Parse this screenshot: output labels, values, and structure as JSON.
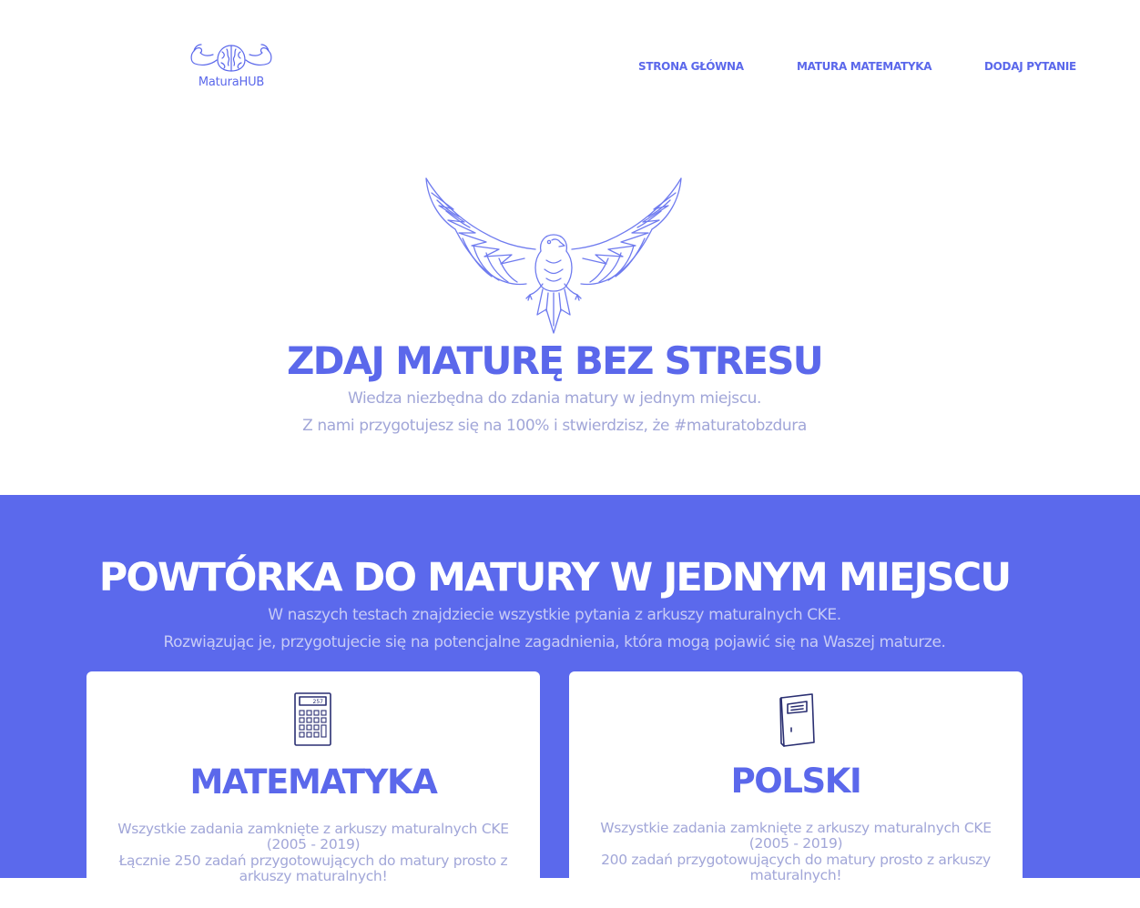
{
  "brand": {
    "logo_text": "MaturaHUB",
    "accent_color": "#5b68eb",
    "band_color": "#5b69ec"
  },
  "nav": {
    "items": [
      {
        "label": "STRONA GŁÓWNA"
      },
      {
        "label": "MATURA MATEMATYKA"
      },
      {
        "label": "DODAJ PYTANIE"
      }
    ]
  },
  "hero": {
    "icon": "eagle-icon",
    "title": "ZDAJ MATURĘ BEZ STRESU",
    "line1": "Wiedza niezbędna do zdania matury w jednym miejscu.",
    "line2": "Z nami przygotujesz się na 100% i stwierdzisz, że #maturatobzdura"
  },
  "section": {
    "title": "POWTÓRKA DO MATURY W JEDNYM MIEJSCU",
    "line1": "W naszych testach znajdziecie wszystkie pytania z arkuszy maturalnych CKE.",
    "line2": "Rozwiązując je, przygotujecie się na potencjalne zagadnienia, która mogą pojawić się na Waszej maturze."
  },
  "cards": [
    {
      "icon": "calculator-icon",
      "title": "MATEMATYKA",
      "text1": "Wszystkie zadania zamknięte z arkuszy maturalnych CKE (2005 - 2019)",
      "text2": "Łącznie 250 zadań przygotowujących do matury prosto z arkuszy maturalnych!"
    },
    {
      "icon": "notebook-icon",
      "title": "POLSKI",
      "text1": "Wszystkie zadania zamknięte z arkuszy maturalnych CKE (2005 - 2019)",
      "text2": "200 zadań przygotowujących do matury prosto z arkuszy maturalnych!"
    }
  ]
}
